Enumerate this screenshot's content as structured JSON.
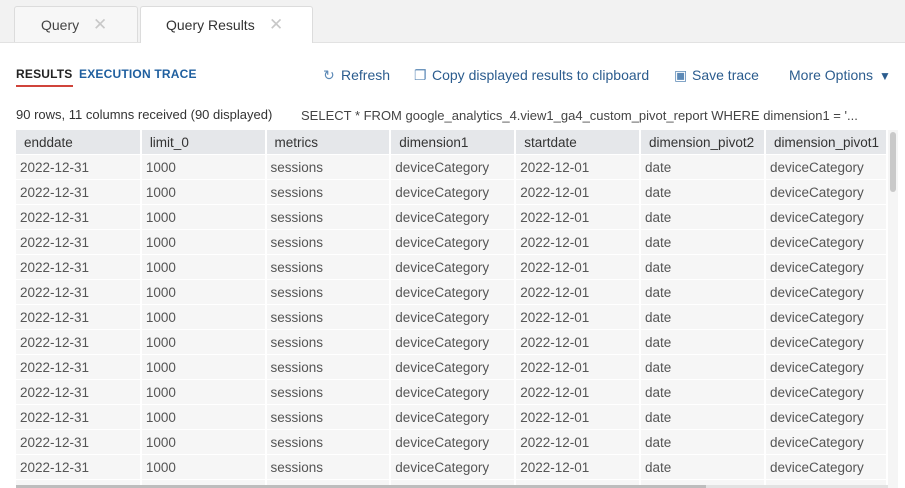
{
  "tabs": [
    {
      "label": "Query",
      "close": "✕"
    },
    {
      "label": "Query Results",
      "close": "✕"
    }
  ],
  "subtabs": {
    "results": "RESULTS",
    "trace": "EXECUTION TRACE"
  },
  "toolbar": {
    "refresh": "Refresh",
    "copy": "Copy displayed results to clipboard",
    "save": "Save trace",
    "more": "More Options"
  },
  "icons": {
    "refresh": "refresh-icon",
    "copy": "copy-icon",
    "save": "save-icon",
    "more": "caret-down-icon"
  },
  "summary": "90 rows, 11 columns received (90 displayed)",
  "query": "SELECT * FROM google_analytics_4.view1_ga4_custom_pivot_report WHERE dimension1 = '...",
  "columns": [
    "enddate",
    "limit_0",
    "metrics",
    "dimension1",
    "startdate",
    "dimension_pivot2",
    "dimension_pivot1"
  ],
  "rows": [
    [
      "2022-12-31",
      "1000",
      "sessions",
      "deviceCategory",
      "2022-12-01",
      "date",
      "deviceCategory"
    ],
    [
      "2022-12-31",
      "1000",
      "sessions",
      "deviceCategory",
      "2022-12-01",
      "date",
      "deviceCategory"
    ],
    [
      "2022-12-31",
      "1000",
      "sessions",
      "deviceCategory",
      "2022-12-01",
      "date",
      "deviceCategory"
    ],
    [
      "2022-12-31",
      "1000",
      "sessions",
      "deviceCategory",
      "2022-12-01",
      "date",
      "deviceCategory"
    ],
    [
      "2022-12-31",
      "1000",
      "sessions",
      "deviceCategory",
      "2022-12-01",
      "date",
      "deviceCategory"
    ],
    [
      "2022-12-31",
      "1000",
      "sessions",
      "deviceCategory",
      "2022-12-01",
      "date",
      "deviceCategory"
    ],
    [
      "2022-12-31",
      "1000",
      "sessions",
      "deviceCategory",
      "2022-12-01",
      "date",
      "deviceCategory"
    ],
    [
      "2022-12-31",
      "1000",
      "sessions",
      "deviceCategory",
      "2022-12-01",
      "date",
      "deviceCategory"
    ],
    [
      "2022-12-31",
      "1000",
      "sessions",
      "deviceCategory",
      "2022-12-01",
      "date",
      "deviceCategory"
    ],
    [
      "2022-12-31",
      "1000",
      "sessions",
      "deviceCategory",
      "2022-12-01",
      "date",
      "deviceCategory"
    ],
    [
      "2022-12-31",
      "1000",
      "sessions",
      "deviceCategory",
      "2022-12-01",
      "date",
      "deviceCategory"
    ],
    [
      "2022-12-31",
      "1000",
      "sessions",
      "deviceCategory",
      "2022-12-01",
      "date",
      "deviceCategory"
    ],
    [
      "2022-12-31",
      "1000",
      "sessions",
      "deviceCategory",
      "2022-12-01",
      "date",
      "deviceCategory"
    ],
    [
      "2022-12-31",
      "1000",
      "sessions",
      "deviceCategory",
      "2022-12-01",
      "date",
      "deviceCategory"
    ]
  ]
}
